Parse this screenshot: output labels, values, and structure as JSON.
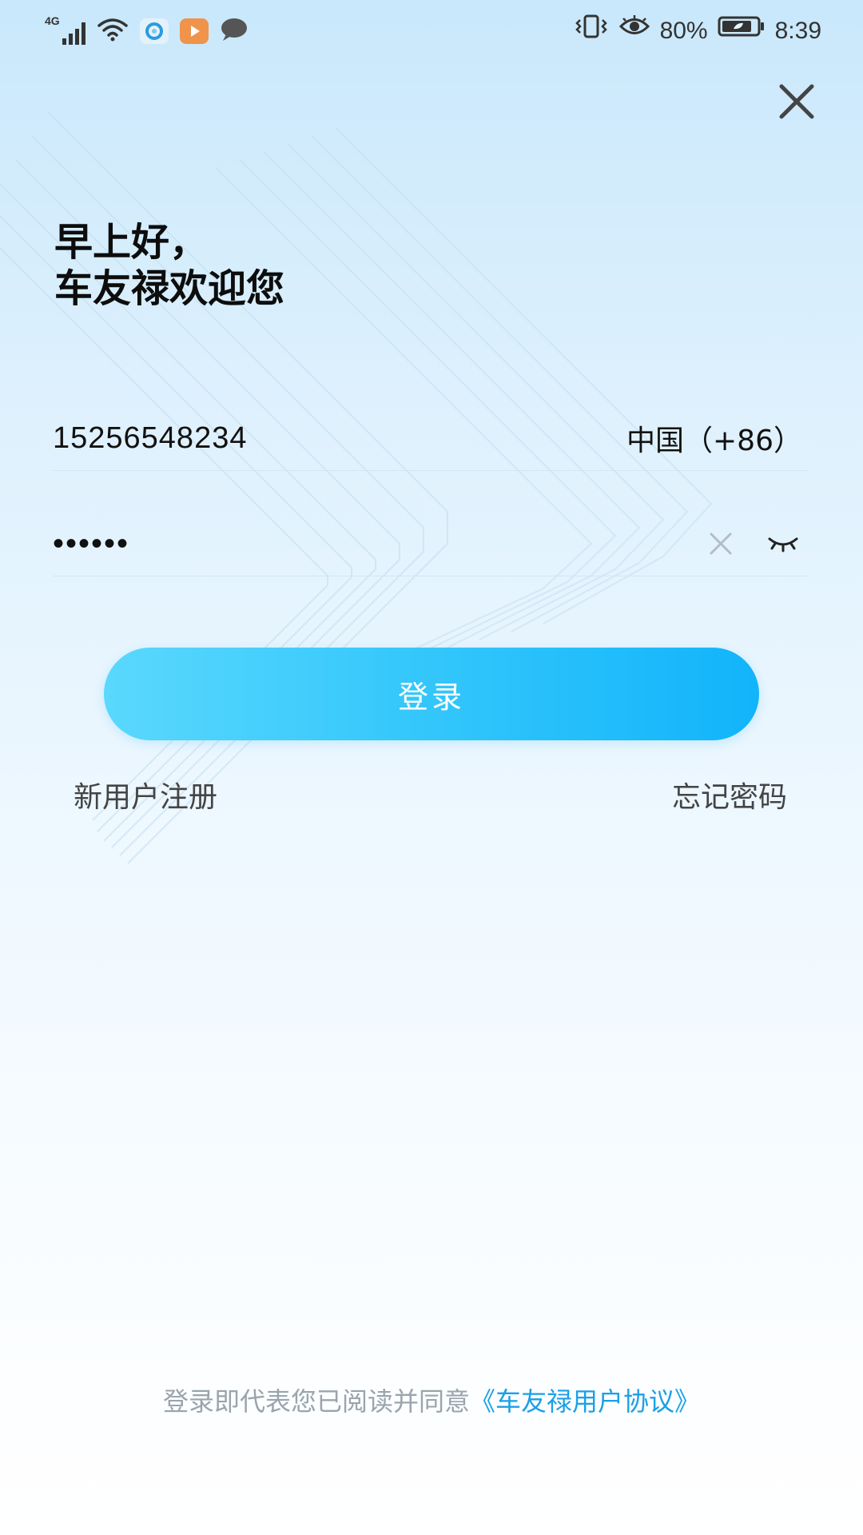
{
  "status_bar": {
    "network_label": "4G",
    "battery_percent": "80%",
    "time": "8:39",
    "icons": [
      "signal-icon",
      "wifi-icon",
      "browser-app-icon",
      "video-app-icon",
      "message-icon",
      "vibrate-icon",
      "eye-comfort-icon",
      "battery-icon"
    ]
  },
  "greeting": {
    "line1": "早上好，",
    "line2": "车友禄欢迎您"
  },
  "phone": {
    "value": "15256548234",
    "country_code": "中国（+86）"
  },
  "password": {
    "value": "••••••"
  },
  "login_label": "登录",
  "register_label": "新用户注册",
  "forgot_label": "忘记密码",
  "agreement": {
    "text": "登录即代表您已阅读并同意",
    "link_text": "《车友禄用户协议》"
  },
  "colors": {
    "accent": "#12b4fb",
    "accent_light": "#5ad8fd",
    "link": "#1aa0e6",
    "muted_text": "#9aa4ad"
  }
}
